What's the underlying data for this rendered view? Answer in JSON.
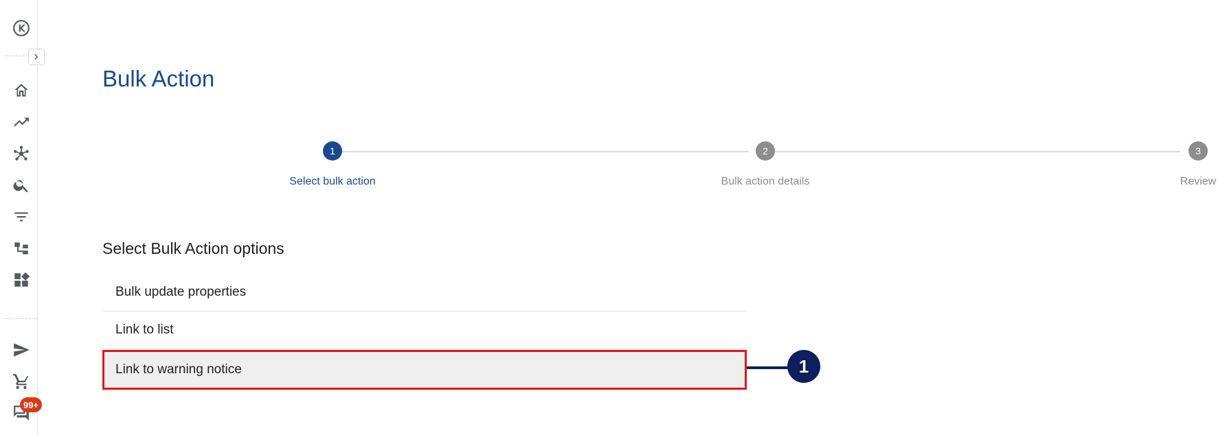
{
  "sidebar": {
    "notification_badge": "99+",
    "icons": [
      "logo-icon",
      "home-icon",
      "trending-icon",
      "network-icon",
      "search-icon",
      "filter-icon",
      "hierarchy-icon",
      "widgets-icon",
      "send-icon",
      "cart-icon",
      "chat-icon"
    ]
  },
  "header": {
    "title": "Bulk Action"
  },
  "stepper": {
    "steps": [
      {
        "number": "1",
        "label": "Select bulk action",
        "state": "active"
      },
      {
        "number": "2",
        "label": "Bulk action details",
        "state": "inactive"
      },
      {
        "number": "3",
        "label": "Review",
        "state": "inactive"
      }
    ]
  },
  "options_section": {
    "heading": "Select Bulk Action options",
    "options": [
      {
        "label": "Bulk update properties"
      },
      {
        "label": "Link to list"
      },
      {
        "label": "Link to warning notice",
        "highlighted": true
      }
    ]
  },
  "callout": {
    "number": "1"
  },
  "colors": {
    "primary": "#1a4a8c",
    "inactive": "#8d8d8d",
    "highlight_border": "#e0141e",
    "callout": "#0d1f5c",
    "badge": "#d83a1a"
  }
}
